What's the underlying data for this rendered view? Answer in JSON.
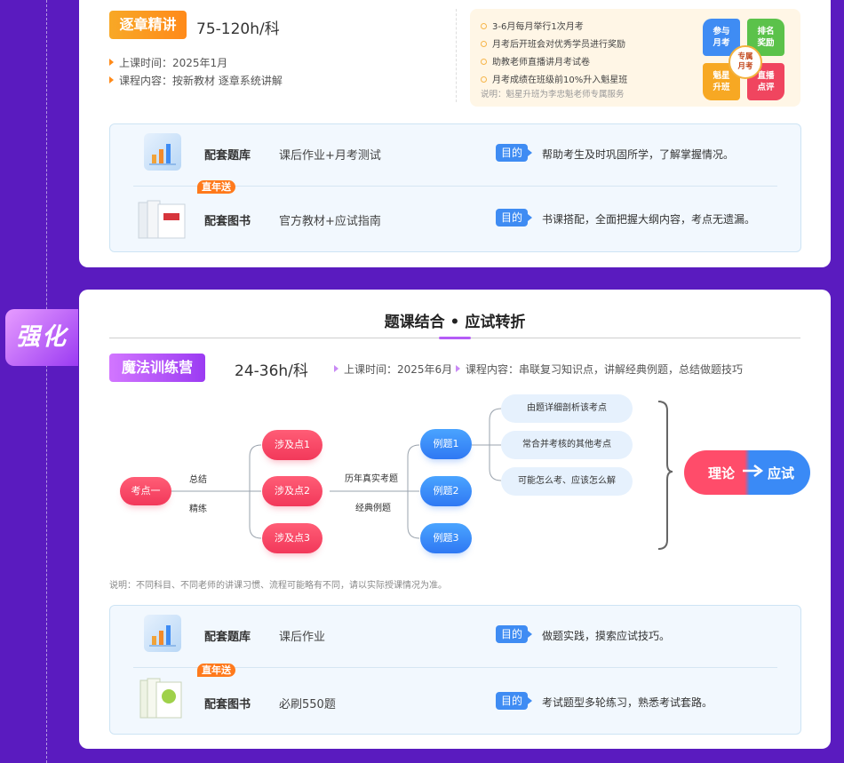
{
  "side_tag": "强化",
  "top": {
    "tag": "逐章精讲",
    "hours": "75-120h/科",
    "time_line": "上课时间：2025年1月",
    "content_line": "课程内容：按新教材 逐章系统讲解",
    "promo": {
      "lines": [
        "3-6月每月举行1次月考",
        "月考后开班会对优秀学员进行奖励",
        "助教老师直播讲月考试卷",
        "月考成绩在班级前10%升入魁星班"
      ],
      "note": "说明：魁星升班为李忠魁老师专属服务",
      "petals": {
        "tl": "参与\n月考",
        "tr": "排名\n奖励",
        "bl": "魁星\n升班",
        "br": "直播\n点评"
      },
      "center": "专属\n月考"
    },
    "resources": [
      {
        "name": "配套题库",
        "desc": "课后作业+月考测试",
        "goal": "目的",
        "goal_text": "帮助考生及时巩固所学，了解掌握情况。"
      },
      {
        "name": "配套图书",
        "desc": "官方教材+应试指南",
        "goal": "目的",
        "goal_text": "书课搭配，全面把握大纲内容，考点无遗漏。",
        "badge": "直年送"
      }
    ]
  },
  "bottom": {
    "title": "题课结合 • 应试转折",
    "tag": "魔法训练营",
    "hours": "24-36h/科",
    "time_line": "上课时间：2025年6月",
    "content_line": "课程内容：串联复习知识点，讲解经典例题，总结做题技巧",
    "diagram": {
      "root": "考点一",
      "root_labels": [
        "总结",
        "精练"
      ],
      "points": [
        "涉及点1",
        "涉及点2",
        "涉及点3"
      ],
      "mid_labels": [
        "历年真实考题",
        "经典例题"
      ],
      "examples": [
        "例题1",
        "例题2",
        "例题3"
      ],
      "leaves": [
        "由题详细剖析该考点",
        "常合并考核的其他考点",
        "可能怎么考、应该怎么解"
      ],
      "result_left": "理论",
      "result_right": "应试"
    },
    "note": "说明：不同科目、不同老师的讲课习惯、流程可能略有不同，请以实际授课情况为准。",
    "resources": [
      {
        "name": "配套题库",
        "desc": "课后作业",
        "goal": "目的",
        "goal_text": "做题实践，摸索应试技巧。"
      },
      {
        "name": "配套图书",
        "desc": "必刷550题",
        "goal": "目的",
        "goal_text": "考试题型多轮练习，熟悉考试套路。",
        "badge": "直年送"
      }
    ]
  },
  "colors": {
    "background": "#5a1bbf",
    "accent_orange": "#ff8a1a",
    "accent_purple": "#b55cf7",
    "accent_blue": "#3f8cf3",
    "accent_red": "#f2385a"
  }
}
